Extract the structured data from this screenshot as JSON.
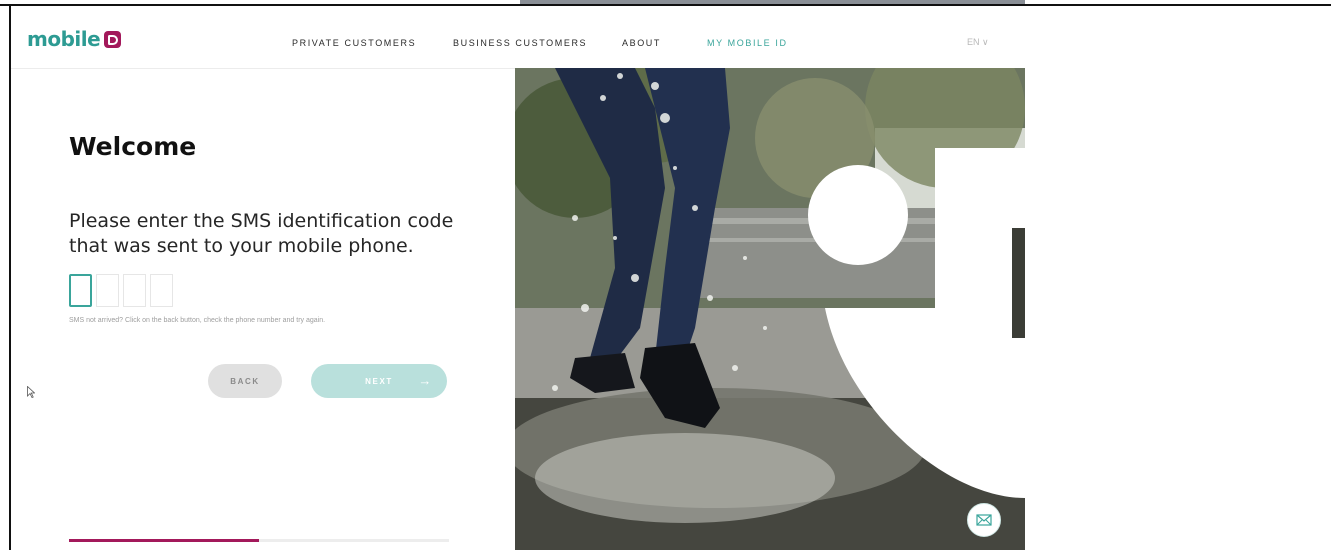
{
  "header": {
    "logo_text": "mobile",
    "nav": [
      {
        "label": "PRIVATE CUSTOMERS",
        "active": false
      },
      {
        "label": "BUSINESS CUSTOMERS",
        "active": false
      },
      {
        "label": "ABOUT",
        "active": false
      },
      {
        "label": "MY MOBILE ID",
        "active": true
      }
    ],
    "language": "EN ∨"
  },
  "main": {
    "title": "Welcome",
    "instruction": "Please enter the SMS identification code that was sent to your mobile phone.",
    "code_values": [
      "",
      "",
      "",
      ""
    ],
    "hint": "SMS not arrived? Click on the back button, check the phone number and try again.",
    "back_label": "BACK",
    "next_label": "NEXT",
    "next_arrow": "→",
    "progress_fraction": 0.5
  },
  "colors": {
    "accent": "#3aa59b",
    "brand": "#a3195b"
  },
  "icons": {
    "mail": "mail-icon",
    "cursor": "cursor-icon"
  }
}
